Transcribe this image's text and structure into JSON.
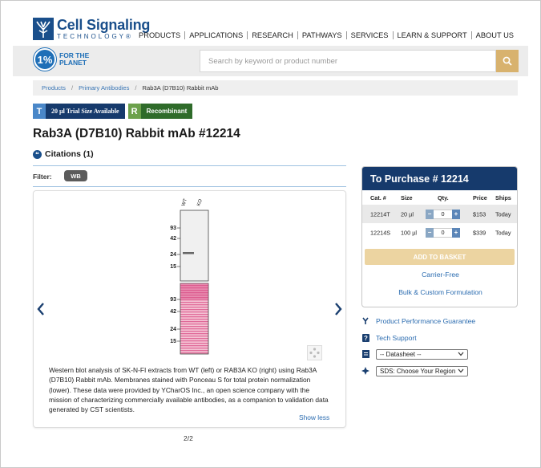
{
  "brand": {
    "name_line1": "Cell Signaling",
    "name_line2": "TECHNOLOGY",
    "color": "#1a4f8b",
    "trademark": "®"
  },
  "nav": [
    "PRODUCTS",
    "APPLICATIONS",
    "RESEARCH",
    "PATHWAYS",
    "SERVICES",
    "LEARN & SUPPORT",
    "ABOUT US"
  ],
  "one_percent": {
    "badge": "1%",
    "line1": "FOR THE",
    "line2": "PLANET"
  },
  "search": {
    "placeholder": "Search by keyword or product number",
    "button_icon": "search-icon"
  },
  "breadcrumb": [
    "Products",
    "Primary Antibodies",
    "Rab3A (D7B10) Rabbit mAb"
  ],
  "badges": [
    {
      "key": "T",
      "label": "20 µl Trial Size Available"
    },
    {
      "key": "R",
      "label": "Recombinant"
    }
  ],
  "product_title": "Rab3A (D7B10) Rabbit mAb #12214",
  "citations": "Citations (1)",
  "filter": {
    "label": "Filter:",
    "value": "WB"
  },
  "blot": {
    "lanes": [
      "WT",
      "KO"
    ],
    "markers_top": [
      "93",
      "42",
      "24",
      "15"
    ],
    "markers_bottom": [
      "93",
      "42",
      "24",
      "15"
    ]
  },
  "caption": "Western blot analysis of SK-N-FI extracts from WT (left) or RAB3A KO (right) using Rab3A (D7B10) Rabbit mAb. Membranes stained with Ponceau S for total protein normalization (lower). These data were provided by YCharOS Inc., an open science company with the mission of characterizing commercially available antibodies, as a companion to validation data generated by CST scientists.",
  "show_less": "Show less",
  "pager": "2/2",
  "purchase": {
    "title": "To Purchase # 12214",
    "headers": [
      "Cat. #",
      "Size",
      "Qty.",
      "Price",
      "Ships"
    ],
    "rows": [
      {
        "cat": "12214T",
        "size": "20 µl",
        "qty": "0",
        "price": "$153",
        "ships": "Today"
      },
      {
        "cat": "12214S",
        "size": "100 µl",
        "qty": "0",
        "price": "$339",
        "ships": "Today"
      }
    ],
    "add_to_basket": "ADD TO BASKET",
    "carrier_free": "Carrier-Free",
    "bulk": "Bulk & Custom Formulation"
  },
  "side_links": {
    "guarantee": "Product Performance Guarantee",
    "tech_support": "Tech Support",
    "datasheet": "-- Datasheet --",
    "sds": "SDS: Choose Your Region"
  }
}
